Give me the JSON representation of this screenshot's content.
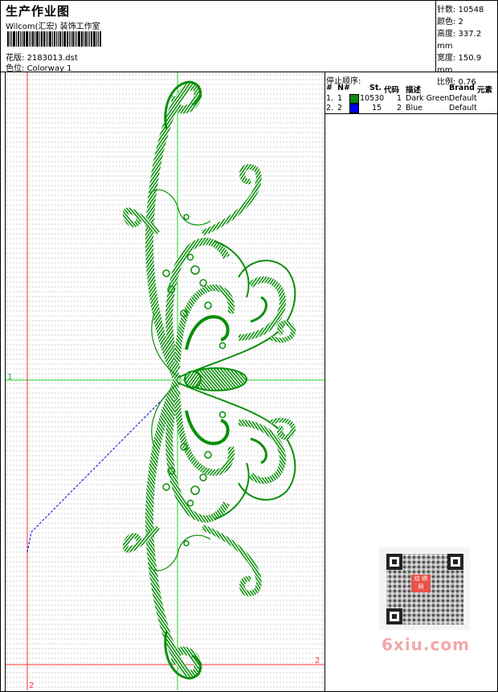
{
  "header": {
    "title": "生产作业图",
    "studio": "Wilcom(汇宏) 装饰工作室",
    "design_label": "花版:",
    "design_value": "2183013.dst",
    "colorway_label": "色位:",
    "colorway_value": "Colorway 1"
  },
  "stats": [
    {
      "label": "针数:",
      "value": "10548"
    },
    {
      "label": "颜色:",
      "value": "2"
    },
    {
      "label": "高度:",
      "value": "337.2 mm"
    },
    {
      "label": "宽度:",
      "value": "150.9 mm"
    },
    {
      "label": "比例:",
      "value": "0.76"
    }
  ],
  "stop_sequence": {
    "title": "停止顺序:",
    "columns": [
      "#",
      "N#",
      "St.",
      "代码",
      "描述",
      "Brand",
      "元素"
    ],
    "rows": [
      {
        "index": "1.",
        "n": "1",
        "stitches": "10530",
        "code": "1",
        "description": "Dark Green",
        "brand": "Default",
        "color": "#0a8a0a"
      },
      {
        "index": "2.",
        "n": "2",
        "stitches": "15",
        "code": "2",
        "description": "Blue",
        "brand": "Default",
        "color": "#0000ee"
      }
    ]
  },
  "canvas": {
    "marker_1_left": "1",
    "marker_2_right": "2",
    "marker_2_bottom": "2",
    "axis_color_green": "#22cc22",
    "axis_color_red": "#ff3333",
    "thread_color": "#0b8f0b",
    "jump_color": "#0000cc"
  },
  "watermark": {
    "seal_text": "纹 绣 网",
    "site": "6xiu.com"
  }
}
